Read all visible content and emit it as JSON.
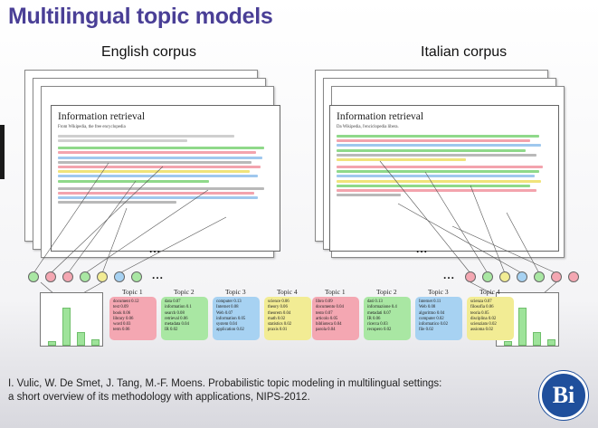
{
  "slide": {
    "title": "Multilingual topic models",
    "citation_line1": "I. Vulic, W. De Smet, J. Tang, M.-F. Moens. Probabilistic topic modeling in multilingual settings:",
    "citation_line2": "a short overview of its methodology with applications, NIPS-2012."
  },
  "english": {
    "heading": "English corpus",
    "doc_title": "Information retrieval",
    "doc_sub": "From Wikipedia, the free encyclopedia",
    "ellipsis": "...",
    "topics": [
      {
        "label": "Topic 1",
        "color": "#f4a7b2",
        "words": [
          "document 0.12",
          "text 0.09",
          "book 0.06",
          "library 0.06",
          "word 0.03",
          "term 0.06"
        ]
      },
      {
        "label": "Topic 2",
        "color": "#a9e7a3",
        "words": [
          "data 0.07",
          "information 0.1",
          "search 0.08",
          "retrieval 0.06",
          "metadata 0.04",
          "IR 0.02"
        ]
      },
      {
        "label": "Topic 3",
        "color": "#a7d2f2",
        "words": [
          "computer 0.13",
          "Internet 0.08",
          "Web 0.07",
          "information 0.05",
          "system 0.04",
          "application 0.02"
        ]
      },
      {
        "label": "Topic 4",
        "color": "#f2ec94",
        "words": [
          "science 0.06",
          "theory 0.06",
          "theorem 0.04",
          "math 0.02",
          "statistics 0.02",
          "praxis 0.01"
        ]
      }
    ]
  },
  "italian": {
    "heading": "Italian corpus",
    "doc_title": "Information retrieval",
    "doc_sub": "Da Wikipedia, l'enciclopedia libera.",
    "ellipsis": "...",
    "topics": [
      {
        "label": "Topic 1",
        "color": "#f4a7b2",
        "words": [
          "libro 0.09",
          "documento 0.04",
          "testo 0.07",
          "articolo 0.05",
          "biblioteca 0.04",
          "parola 0.04"
        ]
      },
      {
        "label": "Topic 2",
        "color": "#a9e7a3",
        "words": [
          "dati 0.13",
          "informazione 0.4",
          "metadati 0.07",
          "IR 0.06",
          "ricerca 0.03",
          "recupero 0.02"
        ]
      },
      {
        "label": "Topic 3",
        "color": "#a7d2f2",
        "words": [
          "Internet 0.11",
          "Web 0.08",
          "algoritmo 0.04",
          "computer 0.02",
          "informatico 0.02",
          "file 0.02"
        ]
      },
      {
        "label": "Topic 4",
        "color": "#f2ec94",
        "words": [
          "scienza 0.07",
          "filosofia 0.06",
          "teoria 0.05",
          "disciplina 0.02",
          "scienziato 0.02",
          "assioma 0.02"
        ]
      }
    ]
  },
  "circle_colors": [
    "#a9e7a3",
    "#f4a7b2",
    "#f4a7b2",
    "#a9e7a3",
    "#f2ec94",
    "#a7d2f2"
  ],
  "histogram_levels": [
    0.08,
    0.72,
    0.25,
    0.12
  ],
  "logo_text": "Вi",
  "colors": {
    "accent": "#4a3f96",
    "logo": "#1f4f9c"
  }
}
